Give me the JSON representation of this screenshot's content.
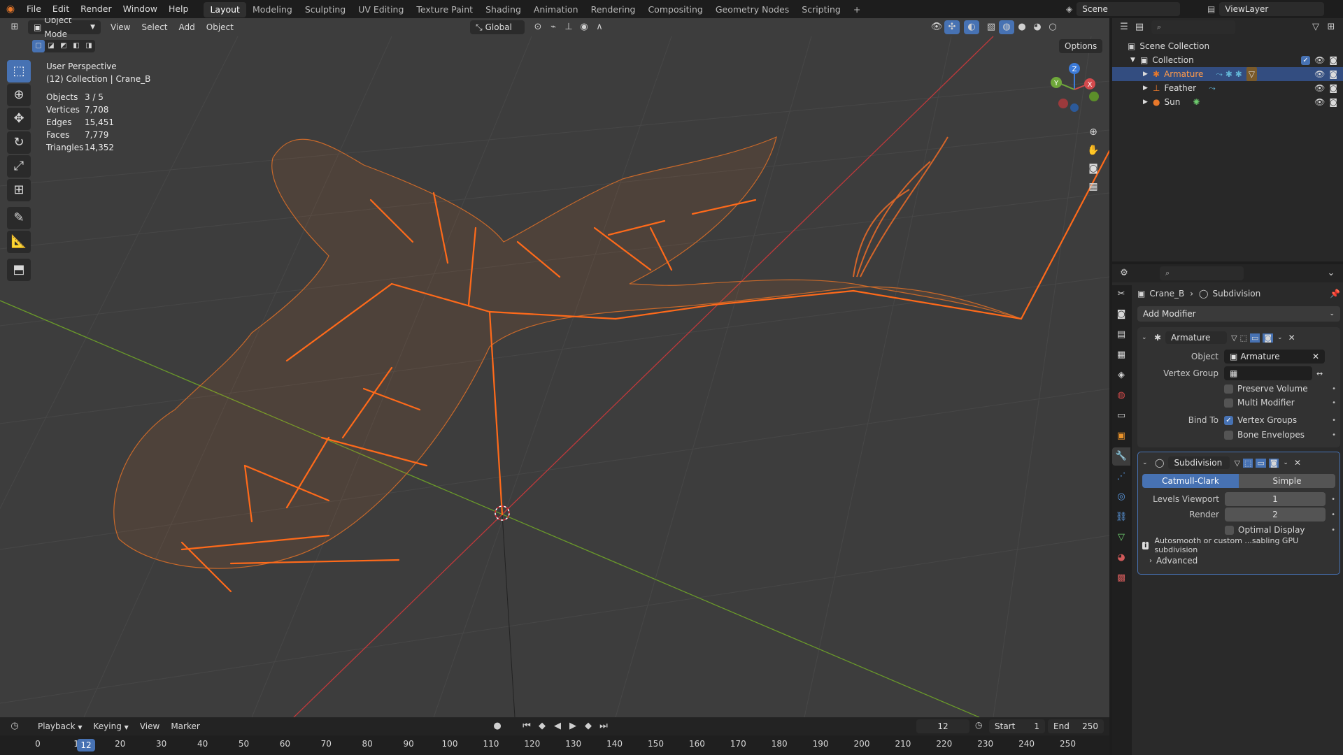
{
  "topbar": {
    "menus": [
      "File",
      "Edit",
      "Render",
      "Window",
      "Help"
    ],
    "workspaces": [
      "Layout",
      "Modeling",
      "Sculpting",
      "UV Editing",
      "Texture Paint",
      "Shading",
      "Animation",
      "Rendering",
      "Compositing",
      "Geometry Nodes",
      "Scripting"
    ],
    "active_workspace": "Layout",
    "add_tab": "+",
    "scene": "Scene",
    "view_layer": "ViewLayer"
  },
  "viewport": {
    "mode": "Object Mode",
    "menus": [
      "View",
      "Select",
      "Add",
      "Object"
    ],
    "orientation": "Global",
    "options_label": "Options",
    "perspective": "User Perspective",
    "collection_info": "(12) Collection | Crane_B",
    "stats": [
      {
        "label": "Objects",
        "value": "3 / 5"
      },
      {
        "label": "Vertices",
        "value": "7,708"
      },
      {
        "label": "Edges",
        "value": "15,451"
      },
      {
        "label": "Faces",
        "value": "7,779"
      },
      {
        "label": "Triangles",
        "value": "14,352"
      }
    ],
    "gizmo_axes": [
      "Z",
      "Y",
      "X"
    ],
    "colors": {
      "background": "#3d3d3d",
      "wire": "#e8782a",
      "x_axis": "#c0393b",
      "y_axis": "#6a9a2a",
      "active": "#4772b3"
    }
  },
  "outliner": {
    "root": "Scene Collection",
    "collection": "Collection",
    "items": [
      {
        "name": "Armature",
        "icon": "armature-icon",
        "selected": true
      },
      {
        "name": "Feather",
        "icon": "bone-icon",
        "selected": false
      },
      {
        "name": "Sun",
        "icon": "light-icon",
        "selected": false
      }
    ]
  },
  "properties": {
    "breadcrumb_object": "Crane_B",
    "breadcrumb_modifier": "Subdivision",
    "add_modifier": "Add Modifier",
    "armature": {
      "name": "Armature",
      "object_label": "Object",
      "object_value": "Armature",
      "vertex_group_label": "Vertex Group",
      "preserve_volume": "Preserve Volume",
      "multi_modifier": "Multi Modifier",
      "bind_to_label": "Bind To",
      "vertex_groups": "Vertex Groups",
      "bone_envelopes": "Bone Envelopes"
    },
    "subdivision": {
      "name": "Subdivision",
      "mode_active": "Catmull-Clark",
      "mode_other": "Simple",
      "levels_viewport_label": "Levels Viewport",
      "levels_viewport": "1",
      "render_label": "Render",
      "render": "2",
      "optimal_display": "Optimal Display",
      "info": "Autosmooth or custom ...sabling GPU subdivision",
      "advanced": "Advanced"
    }
  },
  "timeline": {
    "menus": [
      "Playback",
      "Keying",
      "View",
      "Marker"
    ],
    "current_frame": "12",
    "start_label": "Start",
    "start": "1",
    "end_label": "End",
    "end": "250",
    "ticks": [
      "0",
      "10",
      "20",
      "30",
      "40",
      "50",
      "60",
      "70",
      "80",
      "90",
      "100",
      "110",
      "120",
      "130",
      "140",
      "150",
      "160",
      "170",
      "180",
      "190",
      "200",
      "210",
      "220",
      "230",
      "240",
      "250"
    ]
  }
}
